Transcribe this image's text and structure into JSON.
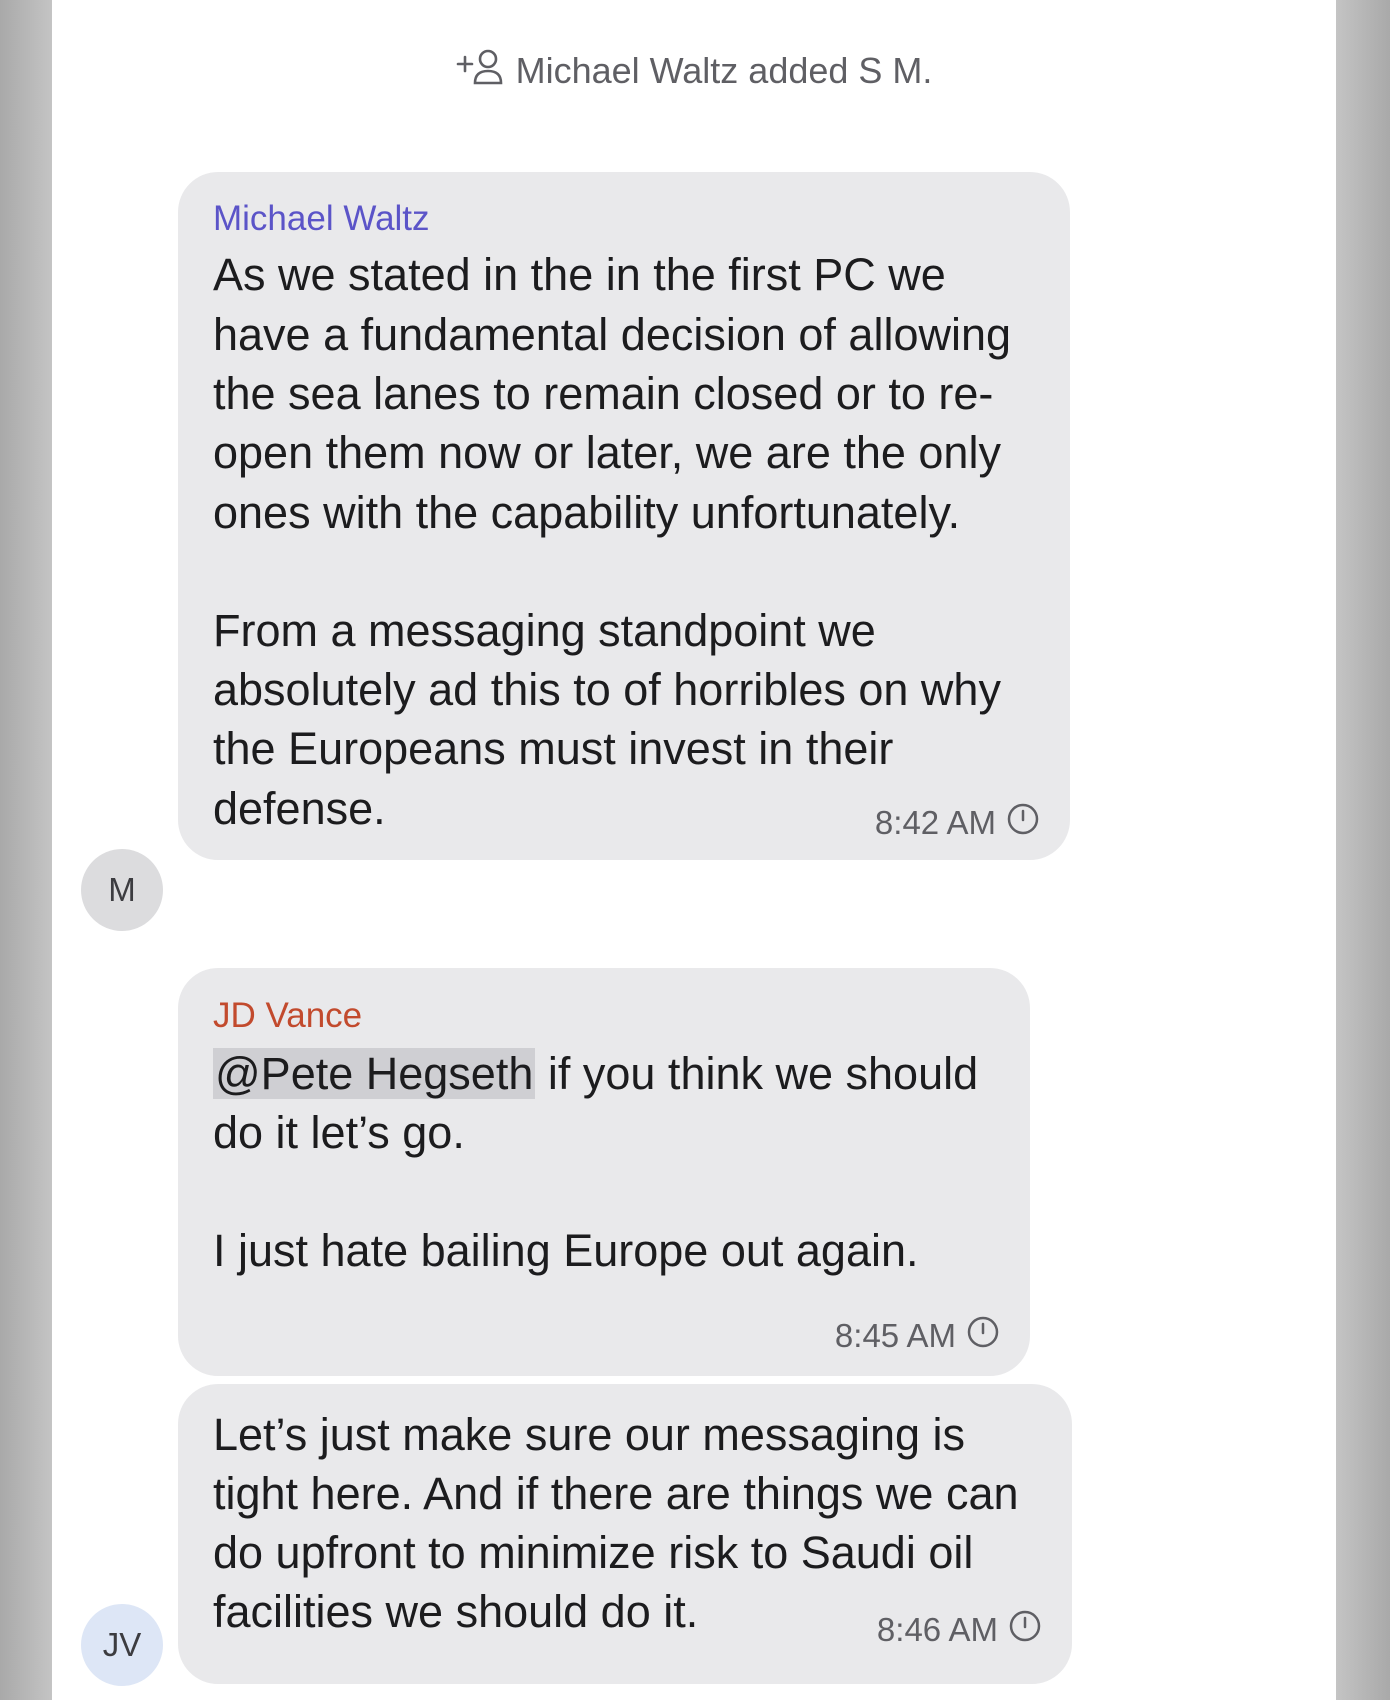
{
  "system_message": {
    "text": "Michael Waltz added S M.",
    "icon": "add-person-icon"
  },
  "messages": [
    {
      "sender": "Michael Waltz",
      "sender_color": "#5b54c8",
      "lines": [
        "As we stated in the in the first PC we",
        "have a fundamental decision of allowing",
        "the sea lanes to remain closed or to re-",
        "open them now or later, we are the only",
        "ones with the capability unfortunately.",
        "From a messaging standpoint we",
        "absolutely ad this to of horribles on why",
        "the Europeans must invest in their",
        "defense."
      ],
      "time": "8:42 AM",
      "avatar": "M"
    },
    {
      "sender": "JD Vance",
      "sender_color": "#c24a2d",
      "mention": "@Pete Hegseth",
      "lines": [
        " if you think we should",
        "do it let’s go.",
        "I just hate bailing Europe out again."
      ],
      "time": "8:45 AM"
    },
    {
      "lines": [
        "Let’s just make sure our messaging is",
        "tight here. And if there are things we can",
        "do upfront to minimize risk to Saudi oil",
        "facilities we should do it."
      ],
      "time": "8:46 AM",
      "avatar": "JV"
    }
  ],
  "colors": {
    "bubble": "#e9e9eb",
    "background": "#ffffff",
    "timestamp": "#5f5f64"
  },
  "icons": {
    "timer": "disappearing-timer-icon"
  }
}
